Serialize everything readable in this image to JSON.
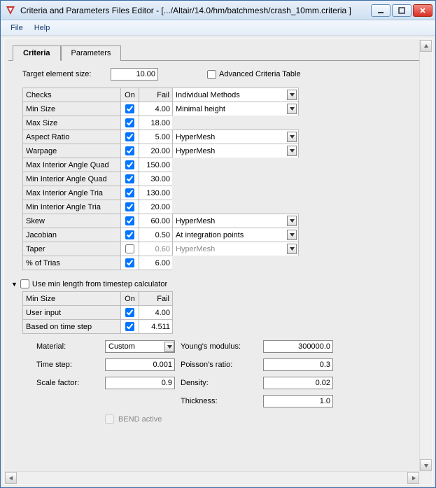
{
  "window": {
    "title": "Criteria and Parameters Files Editor - [.../Altair/14.0/hm/batchmesh/crash_10mm.criteria ]"
  },
  "menu": {
    "file": "File",
    "help": "Help"
  },
  "tabs": {
    "criteria": "Criteria",
    "parameters": "Parameters"
  },
  "target": {
    "label": "Target element size:",
    "value": "10.00",
    "adv_label": "Advanced Criteria Table"
  },
  "headers": {
    "checks": "Checks",
    "on": "On",
    "fail": "Fail",
    "methods": "Individual Methods"
  },
  "rows": [
    {
      "name": "Min Size",
      "on": true,
      "fail": "4.00",
      "method": "Minimal height",
      "dd": true
    },
    {
      "name": "Max Size",
      "on": true,
      "fail": "18.00",
      "method": "",
      "dd": false
    },
    {
      "name": "Aspect Ratio",
      "on": true,
      "fail": "5.00",
      "method": "HyperMesh",
      "dd": true
    },
    {
      "name": "Warpage",
      "on": true,
      "fail": "20.00",
      "method": "HyperMesh",
      "dd": true
    },
    {
      "name": "Max Interior Angle Quad",
      "on": true,
      "fail": "150.00",
      "method": "",
      "dd": false
    },
    {
      "name": "Min Interior Angle Quad",
      "on": true,
      "fail": "30.00",
      "method": "",
      "dd": false
    },
    {
      "name": "Max Interior Angle Tria",
      "on": true,
      "fail": "130.00",
      "method": "",
      "dd": false
    },
    {
      "name": "Min Interior Angle Tria",
      "on": true,
      "fail": "20.00",
      "method": "",
      "dd": false
    },
    {
      "name": "Skew",
      "on": true,
      "fail": "60.00",
      "method": "HyperMesh",
      "dd": true
    },
    {
      "name": "Jacobian",
      "on": true,
      "fail": "0.50",
      "method": "At integration points",
      "dd": true
    },
    {
      "name": "Taper",
      "on": false,
      "fail": "0.60",
      "method": "HyperMesh",
      "dd": true,
      "disabled": true
    },
    {
      "name": "% of Trias",
      "on": true,
      "fail": "6.00",
      "method": "",
      "dd": false
    }
  ],
  "sec2": {
    "label": "Use min length from timestep calculator",
    "headers": {
      "minsize": "Min Size",
      "on": "On",
      "fail": "Fail"
    },
    "rows": [
      {
        "name": "User input",
        "on": true,
        "fail": "4.00"
      },
      {
        "name": "Based on time step",
        "on": true,
        "fail": "4.511"
      }
    ]
  },
  "props": {
    "material_lbl": "Material:",
    "material_val": "Custom",
    "timestep_lbl": "Time step:",
    "timestep_val": "0.001",
    "scale_lbl": "Scale factor:",
    "scale_val": "0.9",
    "young_lbl": "Young's modulus:",
    "young_val": "300000.0",
    "poisson_lbl": "Poisson's ratio:",
    "poisson_val": "0.3",
    "density_lbl": "Density:",
    "density_val": "0.02",
    "thickness_lbl": "Thickness:",
    "thickness_val": "1.0",
    "bend_lbl": "BEND active"
  }
}
